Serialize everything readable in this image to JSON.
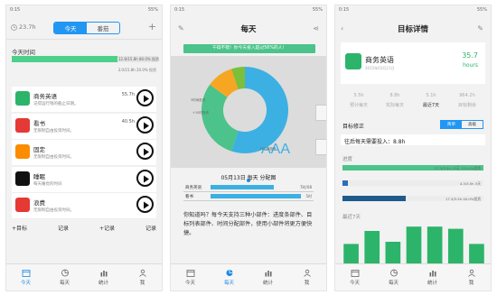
{
  "screen1": {
    "status_time": "0:15",
    "status_battery": "55%",
    "header": {
      "time_value": "23.7h",
      "tabs": [
        "今天",
        "番茄"
      ],
      "add_icon": "plus-icon"
    },
    "today_label": "今天时间",
    "today_bar": {
      "label": "12.8/15.8h 80.0% 投资",
      "progress": 0.8
    },
    "yesterday_label": "3.0/15.8h 20.0% 投资",
    "items": [
      {
        "name": "商务英语",
        "desc": "记得运行钱的截止日期。",
        "hours": "55.7h",
        "color": "#2cb46a"
      },
      {
        "name": "看书",
        "desc": "无限制自由投资时间。",
        "hours": "40.5h",
        "color": "#e53935"
      },
      {
        "name": "固定",
        "desc": "无限制自由投资时间。",
        "hours": "",
        "color": "#fb8c00"
      },
      {
        "name": "睡眠",
        "desc": "每天睡觉的时间",
        "hours": "",
        "color": "#111111"
      },
      {
        "name": "浪费",
        "desc": "无限制自由投资时间。",
        "hours": "",
        "color": "#e53935"
      }
    ],
    "actions": [
      "+目标",
      "记录",
      "+记录",
      "记录"
    ],
    "tabbar": [
      "今天",
      "每天",
      "统计",
      "我"
    ]
  },
  "screen2": {
    "status_time": "0:15",
    "status_battery": "55%",
    "title": "每天",
    "banner": "干得不错！你今天投入超过56%的人！",
    "chart_overlay": "AAA",
    "chart_data": {
      "type": "pie",
      "labels": [
        "商务英语",
        "看书",
        "固定",
        "睡眠"
      ],
      "values": [
        55,
        30,
        10,
        5
      ],
      "colors": [
        "#3cb0e3",
        "#4cc38a",
        "#f6a623",
        "#7cbf3a"
      ],
      "slice_labels": [
        "3时间投资",
        "+10时投资",
        "12时间投资"
      ]
    },
    "date_title": "05月13日 每天 分配图",
    "rows": [
      {
        "name": "商务英语",
        "value": 0.62,
        "label": "7时/08"
      },
      {
        "name": "看书",
        "value": 0.95,
        "label": "5时"
      }
    ],
    "text": "你知道吗？每今天支持三种小部件：进度条部件、目标列表部件、时间分配部件，使用小部件将更方便快捷。",
    "tabbar": [
      "今天",
      "每天",
      "统计",
      "我"
    ]
  },
  "screen3": {
    "status_time": "0:15",
    "status_battery": "55%",
    "title": "目标详情",
    "goal": {
      "name": "商务英语",
      "date": "2015年03月21日",
      "value": "35.7",
      "unit": "hours"
    },
    "stats": [
      {
        "value": "5.5h",
        "label": "预计每天"
      },
      {
        "value": "8.8h",
        "label": "实际每天"
      },
      {
        "value": "5.1h",
        "label": "最近7天"
      },
      {
        "value": "964.2h",
        "label": "目标剩余"
      }
    ],
    "mod_label": "目标修正",
    "mod_btns": [
      "简单",
      "高级"
    ],
    "need_line": "往后每天需要投入：8.8h",
    "progress_title": "进度",
    "progress_bars": [
      {
        "label": "17.3/3.5h 13天 115.0%投资",
        "value": 1.0,
        "color": "#4cc38a"
      },
      {
        "label": "4.3/3.5h 3天",
        "value": 0.04,
        "color": "#2a6fb8"
      },
      {
        "label": "17.3/3.5h 40.0%投资",
        "value": 0.45,
        "color": "#1f5a8c"
      }
    ],
    "recent_title": "最近7天",
    "recent_chart": {
      "type": "bar",
      "values": [
        0.45,
        0.75,
        0.5,
        0.85,
        0.85,
        0.8,
        0.45
      ],
      "color": "#2cb46a"
    },
    "tabbar": [
      "今天",
      "每天",
      "统计",
      "我"
    ]
  }
}
